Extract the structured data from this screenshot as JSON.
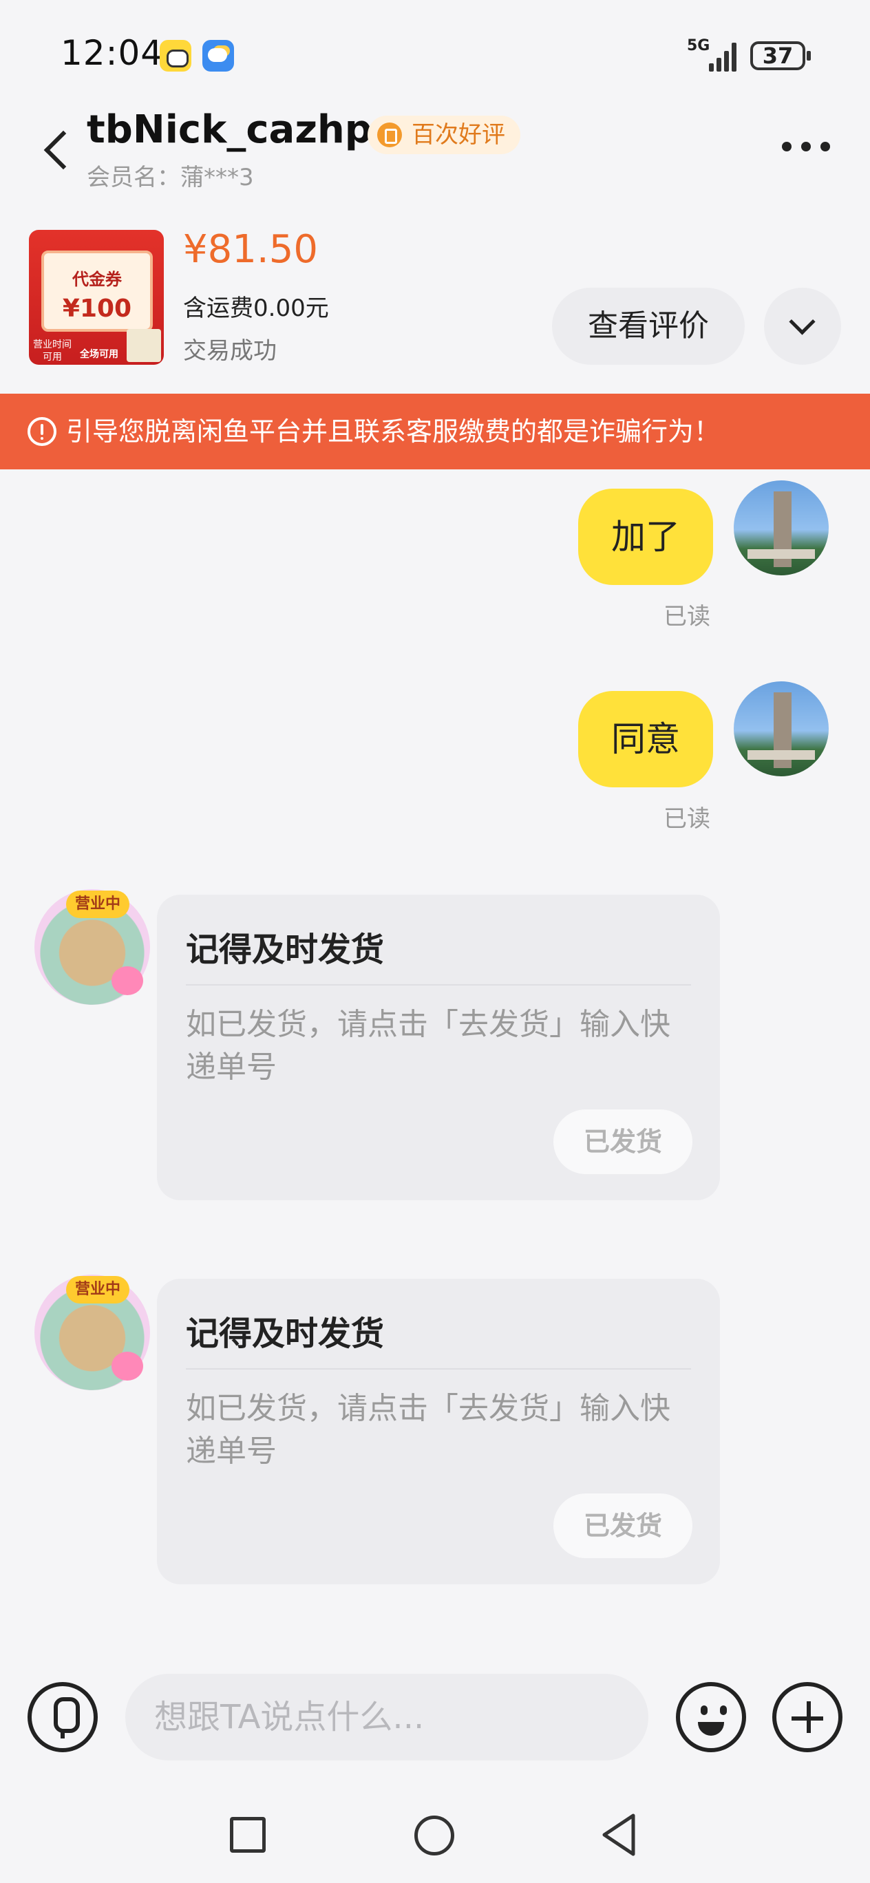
{
  "status_bar": {
    "time": "12:04",
    "network": "5G",
    "battery": "37"
  },
  "header": {
    "username": "tbNick_cazhp",
    "badge": "百次好评",
    "member_label": "会员名：蒲***3"
  },
  "product": {
    "thumb_title": "代金券",
    "thumb_value": "¥100",
    "thumb_tag_left": "营业时间可用",
    "thumb_tag_right": "全场可用",
    "price": "¥81.50",
    "shipping": "含运费0.00元",
    "trade_status": "交易成功",
    "review_button": "查看评价"
  },
  "warning": {
    "text": "引导您脱离闲鱼平台并且联系客服缴费的都是诈骗行为！",
    "color": "#ee5f3b"
  },
  "messages": {
    "sent": [
      {
        "text": "加了",
        "status": "已读"
      },
      {
        "text": "同意",
        "status": "已读"
      }
    ],
    "shop_tag": "营业中",
    "cards": [
      {
        "title": "记得及时发货",
        "body": "如已发货，请点击「去发货」输入快递单号",
        "button": "已发货"
      },
      {
        "title": "记得及时发货",
        "body": "如已发货，请点击「去发货」输入快递单号",
        "button": "已发货"
      }
    ]
  },
  "input_bar": {
    "placeholder": "想跟TA说点什么..."
  },
  "colors": {
    "accent_yellow": "#ffe13a",
    "price_orange": "#ee6b2b"
  }
}
